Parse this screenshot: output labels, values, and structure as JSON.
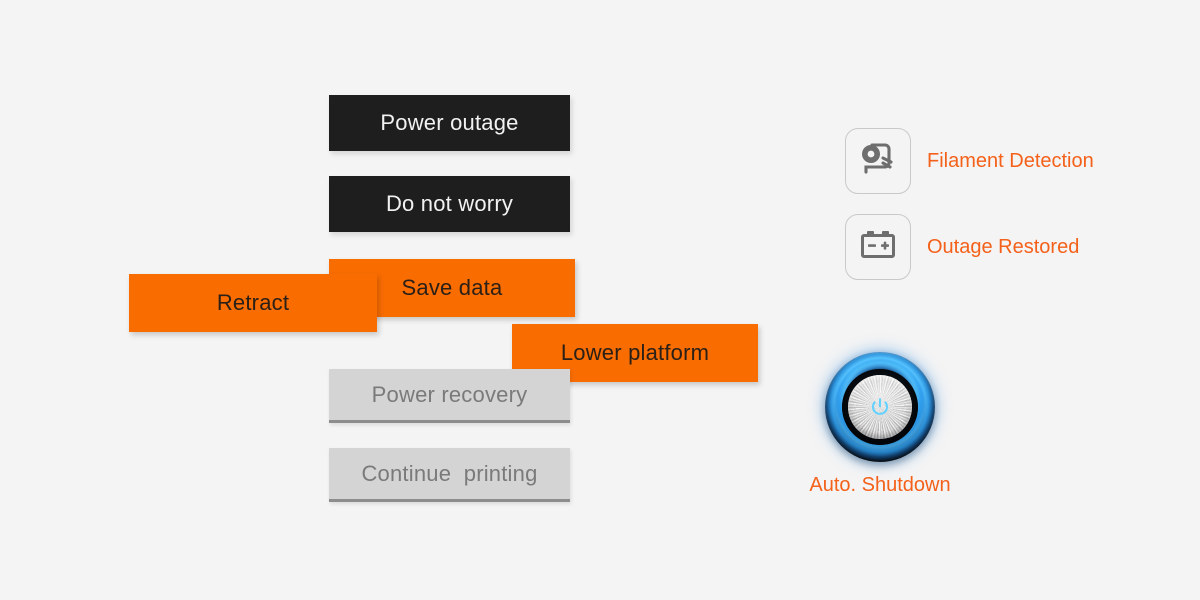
{
  "page": {
    "background_color": "#f4f4f4",
    "accent_orange": "#f4611a",
    "bar_orange": "#f86c00",
    "bar_dark": "#1e1e1e",
    "bar_grey": "#d4d4d4",
    "icon_grey": "#6e6e6e"
  },
  "flow": {
    "bars": [
      {
        "id": "power-outage",
        "label": "Power outage",
        "style": "dark"
      },
      {
        "id": "do-not-worry",
        "label": "Do not worry",
        "style": "dark"
      },
      {
        "id": "save-data",
        "label": "Save data",
        "style": "orange"
      },
      {
        "id": "retract",
        "label": "Retract",
        "style": "orange"
      },
      {
        "id": "lower-platform",
        "label": "Lower platform",
        "style": "orange"
      },
      {
        "id": "power-recovery",
        "label": "Power recovery",
        "style": "grey"
      },
      {
        "id": "continue",
        "label": "Continue  printing",
        "style": "grey"
      }
    ]
  },
  "features": [
    {
      "id": "filament-detection",
      "label": "Filament Detection",
      "icon": "filament-spool-icon"
    },
    {
      "id": "outage-restored",
      "label": "Outage Restored",
      "icon": "battery-icon"
    }
  ],
  "power": {
    "label": "Auto. Shutdown",
    "icon": "power-symbol-icon"
  }
}
